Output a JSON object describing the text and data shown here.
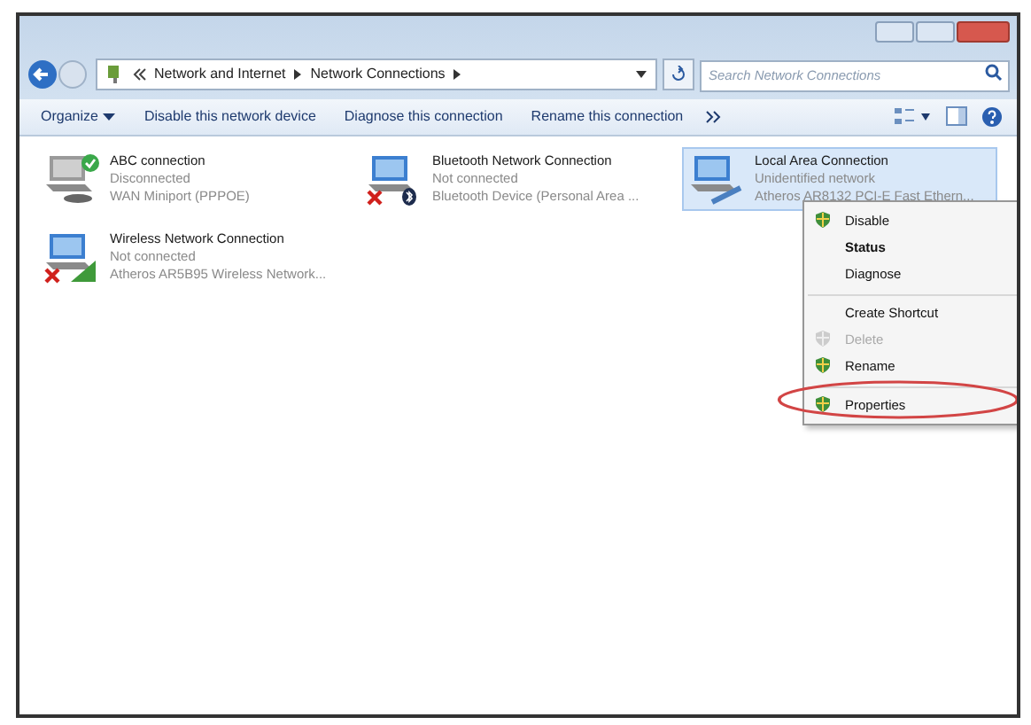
{
  "address": {
    "crumbs": [
      "Network and Internet",
      "Network Connections"
    ]
  },
  "search": {
    "placeholder": "Search Network Connections"
  },
  "toolbar": [
    {
      "label": "Organize",
      "kind": "menu"
    },
    {
      "label": "Disable this network device",
      "kind": "button"
    },
    {
      "label": "Diagnose this connection",
      "kind": "button"
    },
    {
      "label": "Rename this connection",
      "kind": "button"
    }
  ],
  "connections": [
    {
      "name": "ABC connection",
      "status": "Disconnected",
      "device": "WAN Miniport (PPPOE)",
      "kind": "broadband",
      "error": false,
      "selected": false
    },
    {
      "name": "Bluetooth Network Connection",
      "status": "Not connected",
      "device": "Bluetooth Device (Personal Area ...",
      "kind": "bluetooth",
      "error": true,
      "selected": false
    },
    {
      "name": "Local Area Connection",
      "status": "Unidentified network",
      "device": "Atheros AR8132 PCI-E Fast Ethern...",
      "kind": "ethernet",
      "error": false,
      "selected": true
    },
    {
      "name": "Wireless Network Connection",
      "status": "Not connected",
      "device": "Atheros AR5B95 Wireless Network...",
      "kind": "wireless",
      "error": true,
      "selected": false
    }
  ],
  "context_menu": [
    {
      "label": "Disable",
      "shield": true,
      "bold": false,
      "disabled": false,
      "separator_before": false,
      "circled": false
    },
    {
      "label": "Status",
      "shield": false,
      "bold": true,
      "disabled": false,
      "separator_before": false,
      "circled": false
    },
    {
      "label": "Diagnose",
      "shield": false,
      "bold": false,
      "disabled": false,
      "separator_before": false,
      "circled": false
    },
    {
      "label": "Create Shortcut",
      "shield": false,
      "bold": false,
      "disabled": false,
      "separator_before": true,
      "circled": false
    },
    {
      "label": "Delete",
      "shield": true,
      "bold": false,
      "disabled": true,
      "separator_before": false,
      "circled": false
    },
    {
      "label": "Rename",
      "shield": true,
      "bold": false,
      "disabled": false,
      "separator_before": false,
      "circled": false
    },
    {
      "label": "Properties",
      "shield": true,
      "bold": false,
      "disabled": false,
      "separator_before": true,
      "circled": true
    }
  ]
}
